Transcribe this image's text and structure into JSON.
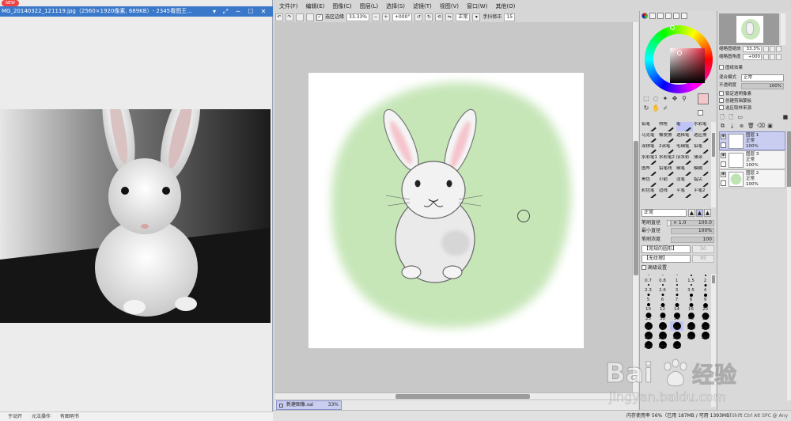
{
  "viewer": {
    "title": "MG_20140322_121119.jpg（2560×1920像素, 689KB）- 2345看图王...",
    "new_badge": "NEW",
    "status_items": [
      "于动开",
      "元法操作",
      "有图明书"
    ]
  },
  "sai": {
    "menu": [
      "文件(F)",
      "编辑(E)",
      "图像(C)",
      "图层(L)",
      "选择(S)",
      "滤镜(T)",
      "视图(V)",
      "窗口(W)",
      "其他(O)"
    ],
    "toolbar": {
      "selection_edge_label": "选区边缘",
      "zoom": "33.33%",
      "angle": "+000°",
      "mode": "正常",
      "stabilizer_label": "手抖修正",
      "stabilizer_value": "15"
    },
    "file_tab": {
      "name": "新建图像.sai",
      "zoom": "33%"
    },
    "status": {
      "memory": "内存使用率 56%（已用 187MB / 可用 1393MB）",
      "keys": "Shift Ctrl Alt SPC @ Any"
    }
  },
  "brushes": [
    {
      "name": "铅笔"
    },
    {
      "name": "喷枪"
    },
    {
      "name": "笔"
    },
    {
      "name": "水彩笔"
    },
    {
      "name": "马克笔"
    },
    {
      "name": "橡皮擦"
    },
    {
      "name": "选择笔"
    },
    {
      "name": "选区擦"
    },
    {
      "name": "涂抹笔"
    },
    {
      "name": "2涂笔"
    },
    {
      "name": "毛细笔"
    },
    {
      "name": "铅笔"
    },
    {
      "name": "水彩笔1"
    },
    {
      "name": "水彩笔2"
    },
    {
      "name": "旧水彩"
    },
    {
      "name": "薄涂"
    },
    {
      "name": "图布"
    },
    {
      "name": "铅笔线"
    },
    {
      "name": "细笔"
    },
    {
      "name": "模糊"
    },
    {
      "name": "黑色"
    },
    {
      "name": "小前"
    },
    {
      "name": "淡笔"
    },
    {
      "name": "指尖"
    },
    {
      "name": "彩色笔"
    },
    {
      "name": "边线"
    },
    {
      "name": "平笔"
    },
    {
      "name": "平笔2"
    }
  ],
  "brush_params": {
    "mode": "正常",
    "size_label": "笔刷直径",
    "size_mult": "× 1.0",
    "size_value": "100.0",
    "min_size_label": "最小直径",
    "min_size_value": "100%",
    "density_label": "笔刷浓度",
    "density_value": "100",
    "shape": "【常规的圆形】",
    "shape_value": "50",
    "texture": "【无纹理】",
    "texture_value": "95",
    "advanced_label": "高级设置"
  },
  "sizes": [
    "0.7",
    "0.8",
    "1",
    "1.5",
    "2",
    "2.3",
    "2.6",
    "3",
    "3.5",
    "4",
    "5",
    "6",
    "7",
    "8",
    "9",
    "10",
    "12",
    "14",
    "16",
    "20",
    "25",
    "30",
    "35",
    "40",
    "50",
    "60",
    "70",
    "80",
    "100",
    "120",
    "160",
    "200",
    "250",
    "300",
    "350",
    "400",
    "450",
    "500"
  ],
  "selected_size": "80",
  "navigator": {
    "zoom_label": "缩略图缩放",
    "zoom_value": "33.3%",
    "angle_label": "缩略图角度",
    "angle_value": "+000"
  },
  "layer_panel": {
    "effects_label": "图纸效果",
    "blend_label": "混合模式",
    "blend_value": "正常",
    "opacity_label": "不透明度",
    "opacity_value": "100%",
    "opt_lock": "锁定透明像素",
    "opt_clip": "创建剪辑蒙板",
    "opt_source": "选区取样来源"
  },
  "layers": [
    {
      "name": "图层 1",
      "mode": "正常",
      "opacity": "100%"
    },
    {
      "name": "图层 3",
      "mode": "正常",
      "opacity": "100%"
    },
    {
      "name": "图层 2",
      "mode": "正常",
      "opacity": "100%"
    }
  ],
  "watermark": {
    "brand": "Bai",
    "brand_cn": "经验",
    "url": "jingyan.baidu.com"
  },
  "colors": {
    "accent_blue": "#3a78c9",
    "sel_layer": "#c9cdf0",
    "green_wash": "#c6e6b8",
    "main_color": "#f3c6c9"
  }
}
